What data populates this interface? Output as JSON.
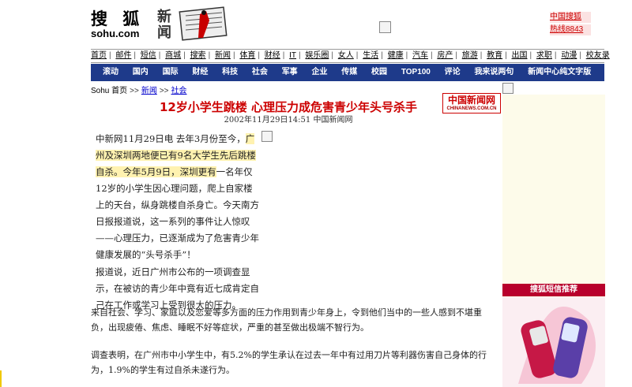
{
  "header": {
    "logo_main": "搜 狐",
    "logo_url": "sohu.com",
    "logo_news": "新闻",
    "ad_lines": [
      "中国搜狐",
      "热线8843"
    ]
  },
  "nav_primary": [
    "首页",
    "邮件",
    "短信",
    "商城",
    "搜索",
    "新闻",
    "体育",
    "财经",
    "IT",
    "娱乐圈",
    "女人",
    "生活",
    "健康",
    "汽车",
    "房产",
    "旅游",
    "教育",
    "出国",
    "求职",
    "动漫",
    "校友录"
  ],
  "nav_secondary": [
    "滚动",
    "国内",
    "国际",
    "财经",
    "科技",
    "社会",
    "军事",
    "企业",
    "传媒",
    "校园",
    "TOP100",
    "评论",
    "我来说两句",
    "新闻中心纯文字版"
  ],
  "breadcrumb": {
    "home": "Sohu 首页",
    "news": "新闻",
    "section": "社会",
    "sep": ">>"
  },
  "article": {
    "title": "12岁小学生跳楼  心理压力成危害青少年头号杀手",
    "meta": "2002年11月29日14:51   中国新闻网",
    "source_logo": "中国新闻网",
    "source_logo_sub": "CHINANEWS.COM.CN",
    "p1_a": "中新网11月29日电  去年3月份至今，",
    "p1_hl": "广州及深圳两地便已有9名大学生先后跳楼自杀。今年5月9日，深圳更有",
    "p1_b": "一名年仅12岁的小学生因心理问题，爬上自家楼上的天台，纵身跳楼自杀身亡。今天南方日报报道说，这一系列的事件让人惊叹——心理压力，已逐渐成为了危害青少年健康发展的“头号杀手”！",
    "p2": "报道说，近日广州市公布的一项调查显示，在被访的青少年中竟有近七成肯定自己在工作或学习上受到很大的压力。",
    "p3": "来自社会、学习、家庭以及恋爱等多方面的压力作用到青少年身上，令到他们当中的一些人感到不堪重负，出现疲倦、焦虑、睡眠不好等症状，严重的甚至做出极端不智行为。",
    "p4": "调查表明，在广州市中小学生中，有5.2%的学生承认在过去一年中有过用刀片等利器伤害自己身体的行为，1.9%的学生有过自杀未遂行为。"
  },
  "sidebar": {
    "promo_title": "搜狐短信推荐"
  }
}
